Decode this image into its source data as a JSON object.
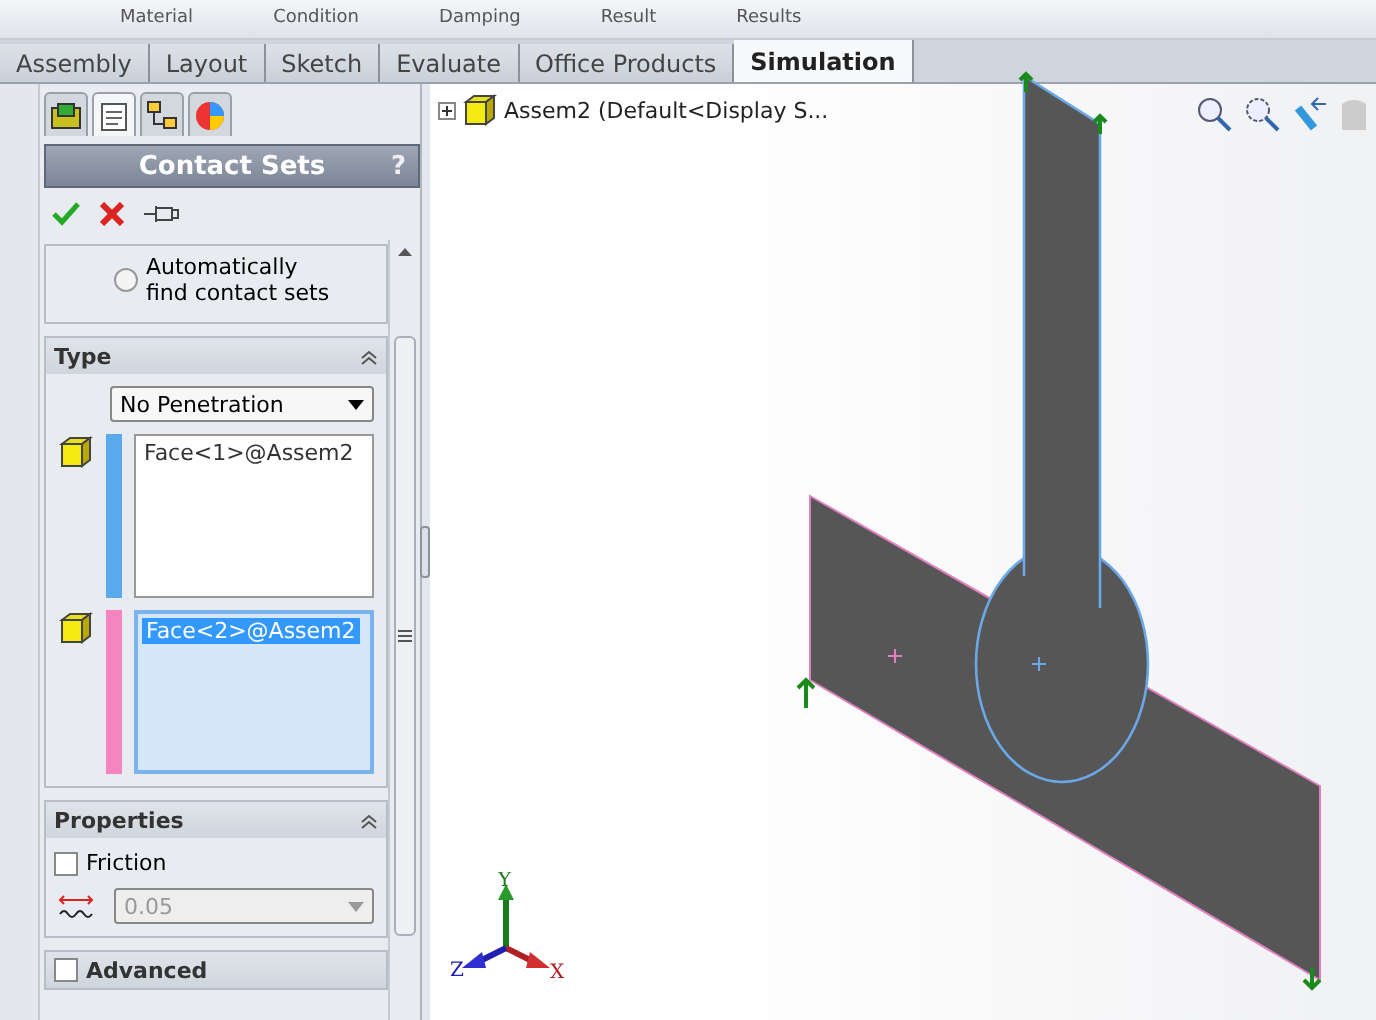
{
  "ribbon": {
    "labels": [
      "Material",
      "Condition",
      "Damping",
      "Result",
      "Results"
    ]
  },
  "tabs": [
    {
      "label": "Assembly",
      "selected": false
    },
    {
      "label": "Layout",
      "selected": false
    },
    {
      "label": "Sketch",
      "selected": false
    },
    {
      "label": "Evaluate",
      "selected": false
    },
    {
      "label": "Office Products",
      "selected": false
    },
    {
      "label": "Simulation",
      "selected": true
    }
  ],
  "panel_tabs": [
    {
      "kind": "assembly",
      "selected": false
    },
    {
      "kind": "property",
      "selected": true
    },
    {
      "kind": "config",
      "selected": false
    },
    {
      "kind": "display",
      "selected": false
    }
  ],
  "panel": {
    "title": "Contact Sets",
    "help": "?"
  },
  "auto_find": {
    "label": "Automatically find contact sets",
    "selected": false
  },
  "type_section": {
    "title": "Type",
    "type_select": "No Penetration",
    "sets": [
      {
        "face": "Face<1>@Assem2",
        "color": "#5aaaf0",
        "active": false
      },
      {
        "face": "Face<2>@Assem2",
        "color": "#f585c0",
        "active": true
      }
    ]
  },
  "properties": {
    "title": "Properties",
    "friction": {
      "label": "Friction",
      "checked": false
    },
    "coefficient": "0.05",
    "coefficient_disabled": true
  },
  "advanced": {
    "title": "Advanced",
    "checked": false
  },
  "tree": {
    "root": "Assem2  (Default<Display S...",
    "expanded": false
  },
  "axes": {
    "x": "X",
    "y": "Y",
    "z": "Z"
  }
}
